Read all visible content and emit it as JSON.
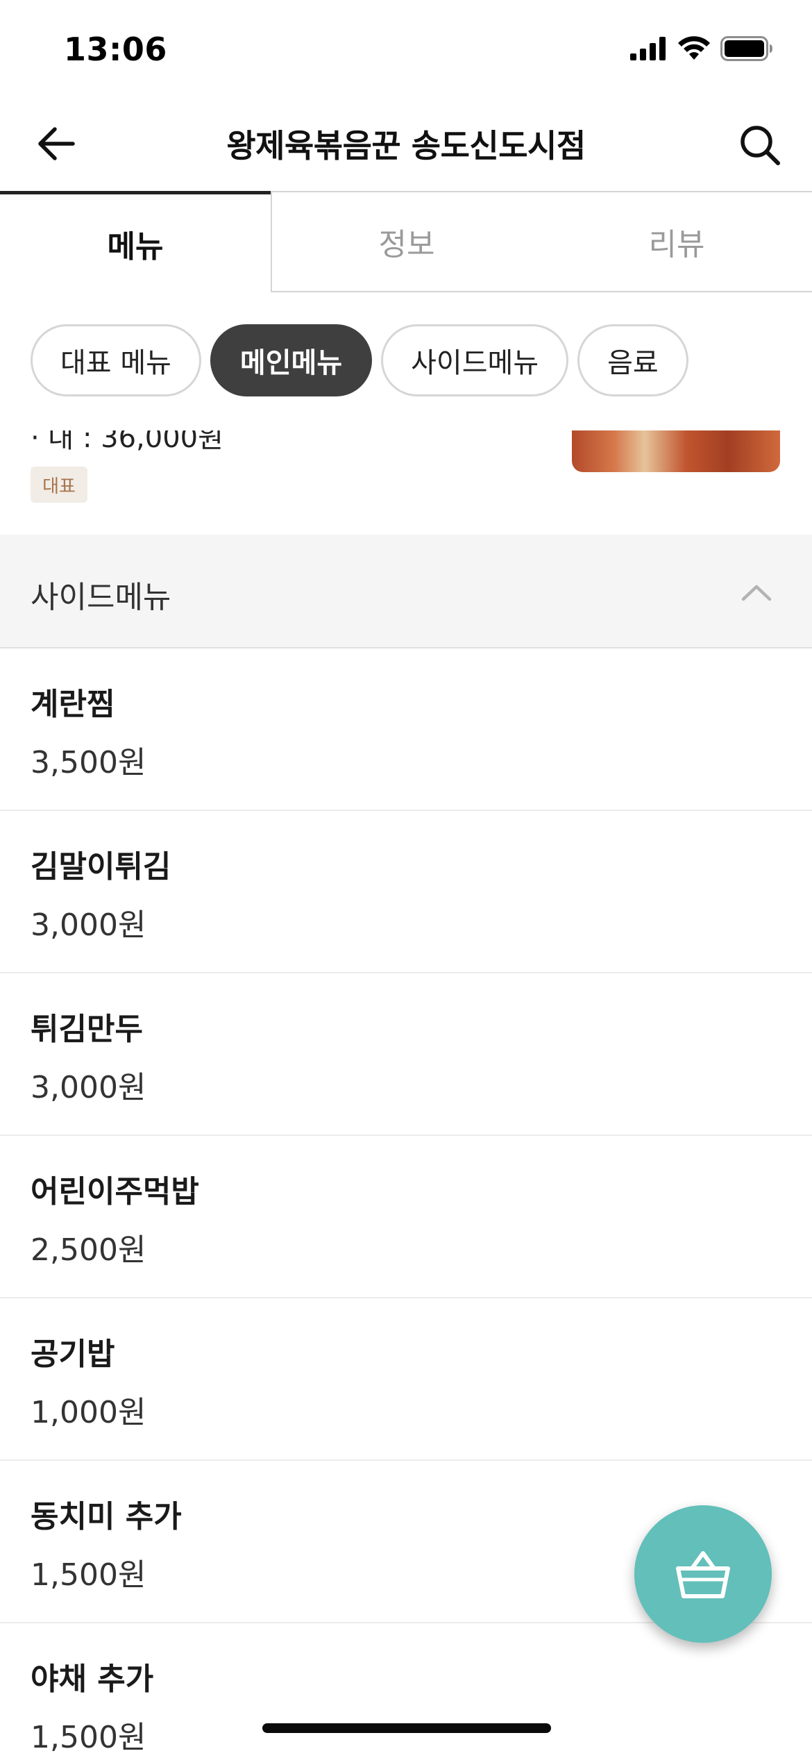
{
  "status_bar": {
    "time": "13:06"
  },
  "header": {
    "title": "왕제육볶음꾼 송도신도시점",
    "back_icon": "arrow-left-icon",
    "search_icon": "search-icon"
  },
  "main_tabs": [
    {
      "label": "메뉴",
      "active": true
    },
    {
      "label": "정보",
      "active": false
    },
    {
      "label": "리뷰",
      "active": false
    }
  ],
  "category_chips": [
    {
      "label": "대표 메뉴",
      "active": false
    },
    {
      "label": "메인메뉴",
      "active": true
    },
    {
      "label": "사이드메뉴",
      "active": false
    },
    {
      "label": "음료",
      "active": false
    }
  ],
  "previous_item": {
    "price_line": "· 대 : 36,000원",
    "badge": "대표"
  },
  "section": {
    "title": "사이드메뉴",
    "collapse_icon": "chevron-up-icon"
  },
  "menu_items": [
    {
      "name": "계란찜",
      "price": "3,500원"
    },
    {
      "name": "김말이튀김",
      "price": "3,000원"
    },
    {
      "name": "튀김만두",
      "price": "3,000원"
    },
    {
      "name": "어린이주먹밥",
      "price": "2,500원"
    },
    {
      "name": "공기밥",
      "price": "1,000원"
    },
    {
      "name": "동치미 추가",
      "price": "1,500원"
    },
    {
      "name": "야채 추가",
      "price": "1,500원"
    }
  ],
  "cart": {
    "icon": "shopping-basket-icon"
  },
  "colors": {
    "accent": "#62bfba",
    "active_chip": "#3f3f3f",
    "badge_bg": "#f1ece6",
    "badge_text": "#a7734a"
  }
}
